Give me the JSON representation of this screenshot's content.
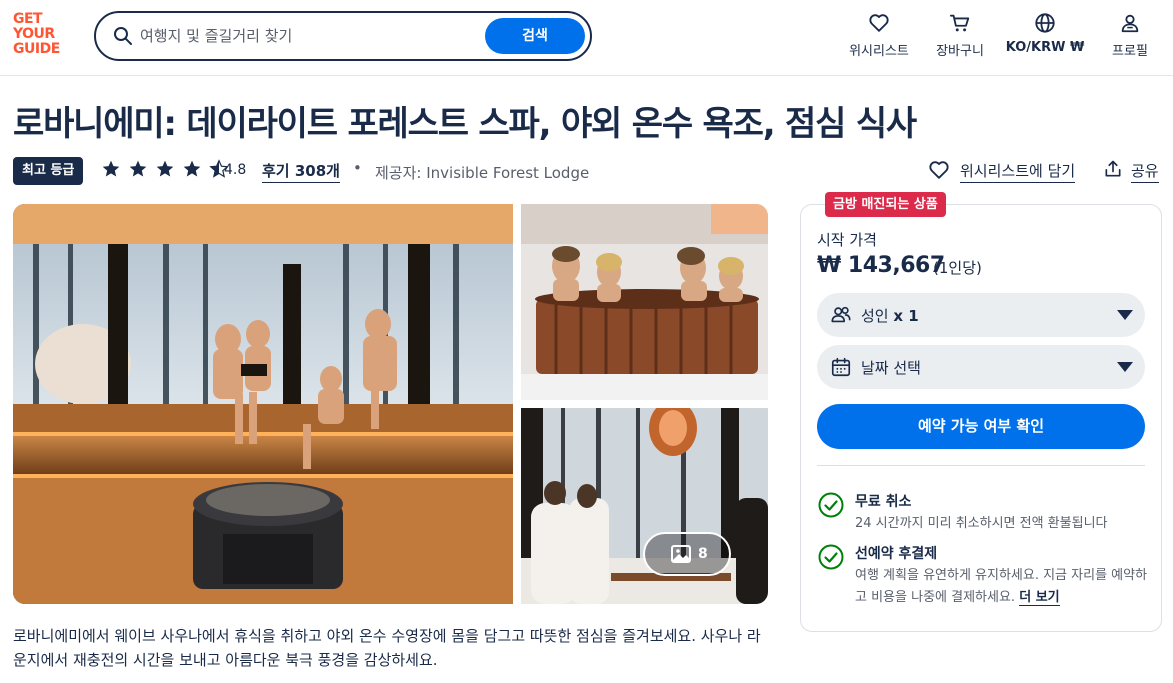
{
  "header": {
    "logo": [
      "GET",
      "YOUR",
      "GUIDE"
    ],
    "search": {
      "placeholder": "여행지 및 즐길거리 찾기",
      "button_label": "검색"
    },
    "nav": [
      {
        "icon": "heart-icon",
        "label": "위시리스트"
      },
      {
        "icon": "cart-icon",
        "label": "장바구니"
      },
      {
        "icon": "globe-icon",
        "label": "KO/KRW ₩"
      },
      {
        "icon": "profile-icon",
        "label": "프로필"
      }
    ]
  },
  "product": {
    "title": "로바니에미: 데이라이트 포레스트 스파, 야외 온수 욕조, 점심 식사",
    "badge": "최고 등급",
    "rating": "4.8",
    "stars": 4.5,
    "reviews_label": "후기 308개",
    "separator": "•",
    "provider": "제공자: Invisible Forest Lodge",
    "wishlist_label": "위시리스트에 담기",
    "share_label": "공유",
    "photo_count": "8",
    "description": "로바니에미에서 웨이브 사우나에서 휴식을 취하고 야외 온수 수영장에 몸을 담그고 따뜻한 점심을 즐겨보세요. 사우나 라운지에서 재충전의 시간을 보내고 아름다운 북극 풍경을 감상하세요."
  },
  "booking": {
    "sale_tag": "금방 매진되는 상품",
    "from_label": "시작 가격",
    "price": "₩ 143,667",
    "per_person": "(1인당)",
    "participants_label": "성인",
    "participants_value": "x 1",
    "date_label": "날짜 선택",
    "check_button": "예약 가능 여부 확인",
    "features": [
      {
        "title": "무료 취소",
        "text": "24 시간까지 미리 취소하시면 전액 환불됩니다"
      },
      {
        "title": "선예약 후결제",
        "text": "여행 계획을 유연하게 유지하세요. 지금 자리를 예약하고 비용을 나중에 결제하세요.",
        "more": "더 보기"
      }
    ]
  },
  "colors": {
    "brand": "#ff5533",
    "primary": "#0071eb",
    "navy": "#1a2b49",
    "sale": "#dc2a4b",
    "success": "#008009"
  }
}
